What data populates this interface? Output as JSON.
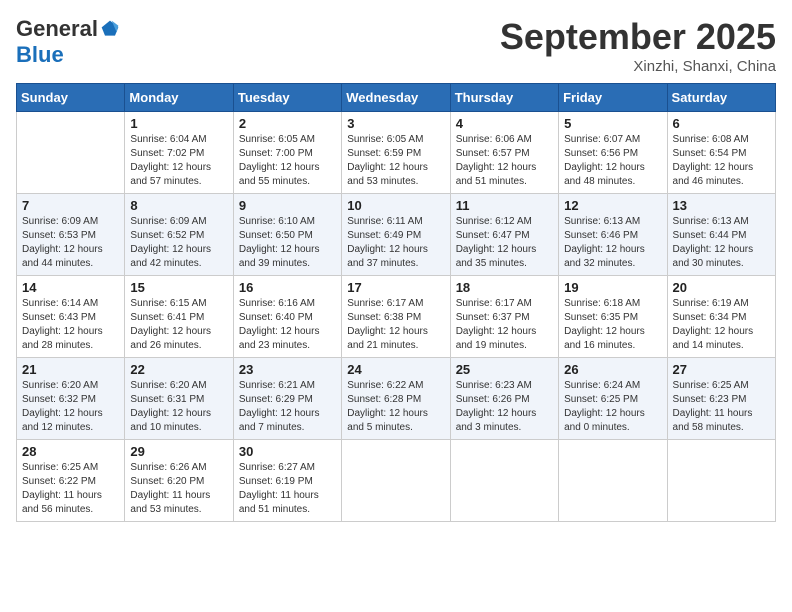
{
  "header": {
    "logo_general": "General",
    "logo_blue": "Blue",
    "month_title": "September 2025",
    "subtitle": "Xinzhi, Shanxi, China"
  },
  "weekdays": [
    "Sunday",
    "Monday",
    "Tuesday",
    "Wednesday",
    "Thursday",
    "Friday",
    "Saturday"
  ],
  "weeks": [
    [
      {
        "date": "",
        "sunrise": "",
        "sunset": "",
        "daylight": ""
      },
      {
        "date": "1",
        "sunrise": "Sunrise: 6:04 AM",
        "sunset": "Sunset: 7:02 PM",
        "daylight": "Daylight: 12 hours and 57 minutes."
      },
      {
        "date": "2",
        "sunrise": "Sunrise: 6:05 AM",
        "sunset": "Sunset: 7:00 PM",
        "daylight": "Daylight: 12 hours and 55 minutes."
      },
      {
        "date": "3",
        "sunrise": "Sunrise: 6:05 AM",
        "sunset": "Sunset: 6:59 PM",
        "daylight": "Daylight: 12 hours and 53 minutes."
      },
      {
        "date": "4",
        "sunrise": "Sunrise: 6:06 AM",
        "sunset": "Sunset: 6:57 PM",
        "daylight": "Daylight: 12 hours and 51 minutes."
      },
      {
        "date": "5",
        "sunrise": "Sunrise: 6:07 AM",
        "sunset": "Sunset: 6:56 PM",
        "daylight": "Daylight: 12 hours and 48 minutes."
      },
      {
        "date": "6",
        "sunrise": "Sunrise: 6:08 AM",
        "sunset": "Sunset: 6:54 PM",
        "daylight": "Daylight: 12 hours and 46 minutes."
      }
    ],
    [
      {
        "date": "7",
        "sunrise": "Sunrise: 6:09 AM",
        "sunset": "Sunset: 6:53 PM",
        "daylight": "Daylight: 12 hours and 44 minutes."
      },
      {
        "date": "8",
        "sunrise": "Sunrise: 6:09 AM",
        "sunset": "Sunset: 6:52 PM",
        "daylight": "Daylight: 12 hours and 42 minutes."
      },
      {
        "date": "9",
        "sunrise": "Sunrise: 6:10 AM",
        "sunset": "Sunset: 6:50 PM",
        "daylight": "Daylight: 12 hours and 39 minutes."
      },
      {
        "date": "10",
        "sunrise": "Sunrise: 6:11 AM",
        "sunset": "Sunset: 6:49 PM",
        "daylight": "Daylight: 12 hours and 37 minutes."
      },
      {
        "date": "11",
        "sunrise": "Sunrise: 6:12 AM",
        "sunset": "Sunset: 6:47 PM",
        "daylight": "Daylight: 12 hours and 35 minutes."
      },
      {
        "date": "12",
        "sunrise": "Sunrise: 6:13 AM",
        "sunset": "Sunset: 6:46 PM",
        "daylight": "Daylight: 12 hours and 32 minutes."
      },
      {
        "date": "13",
        "sunrise": "Sunrise: 6:13 AM",
        "sunset": "Sunset: 6:44 PM",
        "daylight": "Daylight: 12 hours and 30 minutes."
      }
    ],
    [
      {
        "date": "14",
        "sunrise": "Sunrise: 6:14 AM",
        "sunset": "Sunset: 6:43 PM",
        "daylight": "Daylight: 12 hours and 28 minutes."
      },
      {
        "date": "15",
        "sunrise": "Sunrise: 6:15 AM",
        "sunset": "Sunset: 6:41 PM",
        "daylight": "Daylight: 12 hours and 26 minutes."
      },
      {
        "date": "16",
        "sunrise": "Sunrise: 6:16 AM",
        "sunset": "Sunset: 6:40 PM",
        "daylight": "Daylight: 12 hours and 23 minutes."
      },
      {
        "date": "17",
        "sunrise": "Sunrise: 6:17 AM",
        "sunset": "Sunset: 6:38 PM",
        "daylight": "Daylight: 12 hours and 21 minutes."
      },
      {
        "date": "18",
        "sunrise": "Sunrise: 6:17 AM",
        "sunset": "Sunset: 6:37 PM",
        "daylight": "Daylight: 12 hours and 19 minutes."
      },
      {
        "date": "19",
        "sunrise": "Sunrise: 6:18 AM",
        "sunset": "Sunset: 6:35 PM",
        "daylight": "Daylight: 12 hours and 16 minutes."
      },
      {
        "date": "20",
        "sunrise": "Sunrise: 6:19 AM",
        "sunset": "Sunset: 6:34 PM",
        "daylight": "Daylight: 12 hours and 14 minutes."
      }
    ],
    [
      {
        "date": "21",
        "sunrise": "Sunrise: 6:20 AM",
        "sunset": "Sunset: 6:32 PM",
        "daylight": "Daylight: 12 hours and 12 minutes."
      },
      {
        "date": "22",
        "sunrise": "Sunrise: 6:20 AM",
        "sunset": "Sunset: 6:31 PM",
        "daylight": "Daylight: 12 hours and 10 minutes."
      },
      {
        "date": "23",
        "sunrise": "Sunrise: 6:21 AM",
        "sunset": "Sunset: 6:29 PM",
        "daylight": "Daylight: 12 hours and 7 minutes."
      },
      {
        "date": "24",
        "sunrise": "Sunrise: 6:22 AM",
        "sunset": "Sunset: 6:28 PM",
        "daylight": "Daylight: 12 hours and 5 minutes."
      },
      {
        "date": "25",
        "sunrise": "Sunrise: 6:23 AM",
        "sunset": "Sunset: 6:26 PM",
        "daylight": "Daylight: 12 hours and 3 minutes."
      },
      {
        "date": "26",
        "sunrise": "Sunrise: 6:24 AM",
        "sunset": "Sunset: 6:25 PM",
        "daylight": "Daylight: 12 hours and 0 minutes."
      },
      {
        "date": "27",
        "sunrise": "Sunrise: 6:25 AM",
        "sunset": "Sunset: 6:23 PM",
        "daylight": "Daylight: 11 hours and 58 minutes."
      }
    ],
    [
      {
        "date": "28",
        "sunrise": "Sunrise: 6:25 AM",
        "sunset": "Sunset: 6:22 PM",
        "daylight": "Daylight: 11 hours and 56 minutes."
      },
      {
        "date": "29",
        "sunrise": "Sunrise: 6:26 AM",
        "sunset": "Sunset: 6:20 PM",
        "daylight": "Daylight: 11 hours and 53 minutes."
      },
      {
        "date": "30",
        "sunrise": "Sunrise: 6:27 AM",
        "sunset": "Sunset: 6:19 PM",
        "daylight": "Daylight: 11 hours and 51 minutes."
      },
      {
        "date": "",
        "sunrise": "",
        "sunset": "",
        "daylight": ""
      },
      {
        "date": "",
        "sunrise": "",
        "sunset": "",
        "daylight": ""
      },
      {
        "date": "",
        "sunrise": "",
        "sunset": "",
        "daylight": ""
      },
      {
        "date": "",
        "sunrise": "",
        "sunset": "",
        "daylight": ""
      }
    ]
  ]
}
